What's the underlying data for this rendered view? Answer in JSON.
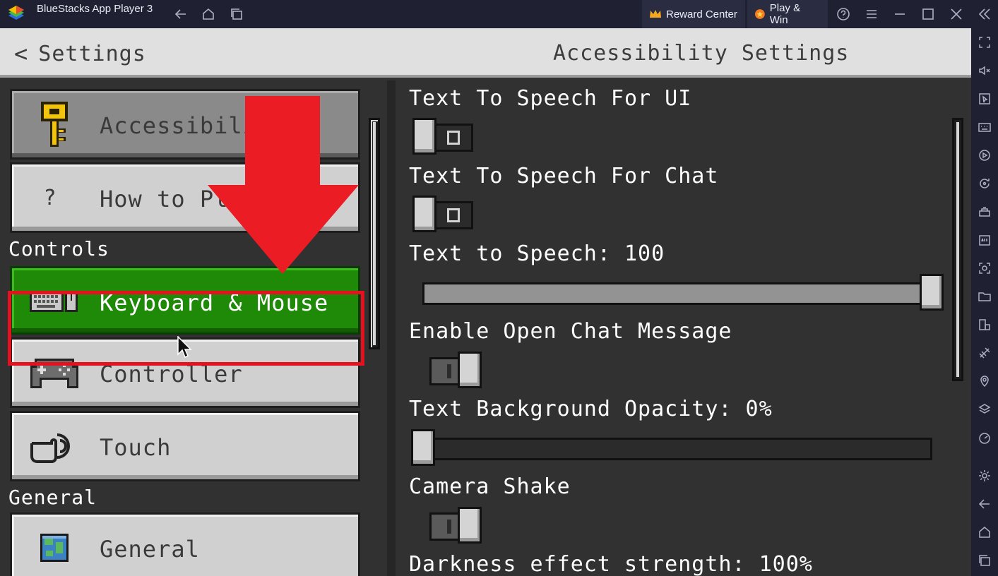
{
  "window": {
    "app_title": "BlueStacks App Player 3",
    "reward_center_label": "Reward Center",
    "play_win_label": "Play & Win"
  },
  "header": {
    "back_label": "Settings",
    "page_title": "Accessibility Settings"
  },
  "nav": {
    "items": [
      {
        "label": "Accessibility",
        "icon": "key-icon",
        "state": "selected"
      },
      {
        "label": "How to Play",
        "icon": "question-icon",
        "glyph": "?"
      },
      {
        "label": "Keyboard & Mouse",
        "icon": "keyboard-mouse-icon",
        "state": "highlighted"
      },
      {
        "label": "Controller",
        "icon": "gamepad-icon"
      },
      {
        "label": "Touch",
        "icon": "touch-hand-icon"
      },
      {
        "label": "General",
        "icon": "globe-cube-icon"
      }
    ],
    "sections": {
      "controls": "Controls",
      "general": "General"
    }
  },
  "settings": {
    "tts_ui": {
      "label": "Text To Speech For UI",
      "value": "off",
      "mark": "O"
    },
    "tts_chat": {
      "label": "Text To Speech For Chat",
      "value": "off",
      "mark": "O"
    },
    "tts_volume": {
      "label": "Text to Speech: 100",
      "value": 100
    },
    "open_chat": {
      "label": "Enable Open Chat Message",
      "value": "on"
    },
    "bg_opacity": {
      "label": "Text Background Opacity: 0%",
      "value": 0
    },
    "camera_shake": {
      "label": "Camera Shake",
      "value": "on"
    },
    "darkness": {
      "label": "Darkness effect strength: 100%",
      "value": 100
    }
  },
  "annotation": {
    "arrow_color": "#ec1c24",
    "box_color": "#e3121e"
  },
  "colors": {
    "button_green": "#1e8a08",
    "panel_bg": "#313131",
    "titlebar_bg": "#1f2133"
  }
}
